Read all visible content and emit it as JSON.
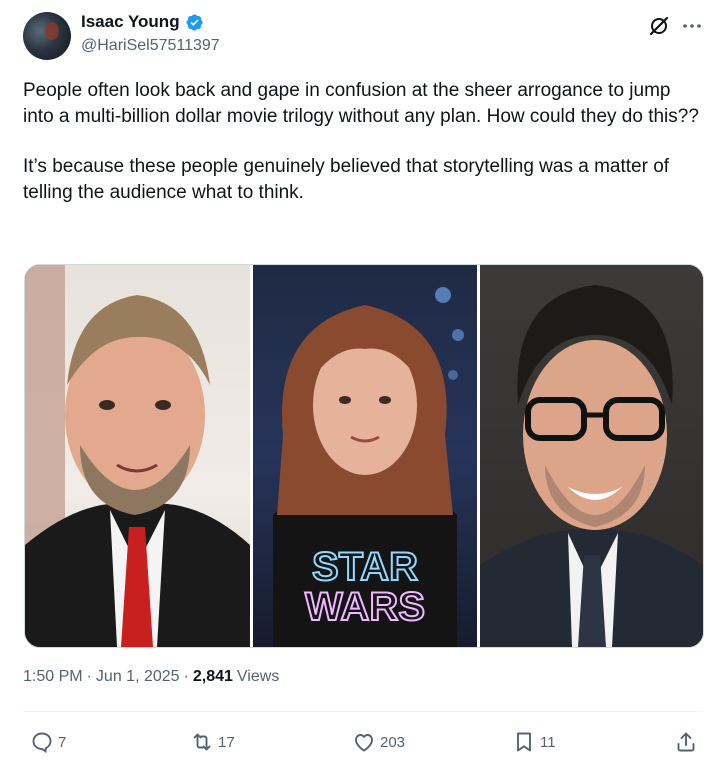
{
  "tweet": {
    "author": {
      "display_name": "Isaac Young",
      "handle": "@HariSel57511397",
      "verified": true
    },
    "body": [
      "People often look back and gape in confusion at the sheer arrogance to jump into a multi-billion dollar movie trilogy without any plan. How could they do this??",
      "It’s because these people genuinely believed that storytelling was a matter of telling the audience what to think."
    ],
    "media": {
      "shirt_text_line1": "STAR",
      "shirt_text_line2": "WARS"
    },
    "meta": {
      "time": "1:50 PM",
      "separator": "·",
      "date": "Jun 1, 2025",
      "separator2": "·",
      "views_count": "2,841",
      "views_label": "Views"
    },
    "actions": {
      "replies": "7",
      "reposts": "17",
      "likes": "203",
      "bookmarks": "11"
    }
  },
  "colors": {
    "text": "#0f1419",
    "secondary": "#536471",
    "verified_blue": "#1d9bf0",
    "divider": "#eff3f4"
  },
  "icons": [
    "verified-badge-icon",
    "grok-icon",
    "more-icon",
    "reply-icon",
    "repost-icon",
    "like-icon",
    "bookmark-icon",
    "share-icon"
  ]
}
